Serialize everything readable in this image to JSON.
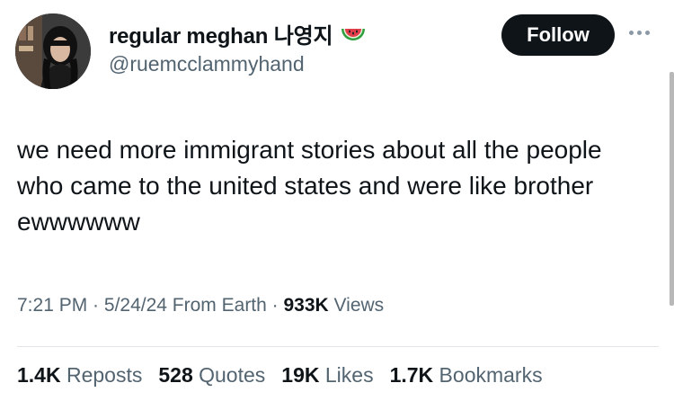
{
  "author": {
    "display_name": "regular meghan 나영지",
    "handle": "@ruemcclammyhand",
    "emoji_icon": "watermelon-icon"
  },
  "follow_label": "Follow",
  "tweet": {
    "text": "we need more immigrant stories about all the people who came to the united states and were like brother ewwwwww"
  },
  "meta": {
    "time": "7:21 PM",
    "sep1": " · ",
    "date": "5/24/24",
    "source": " From Earth",
    "sep2": " · ",
    "views_count": "933K",
    "views_label": " Views"
  },
  "stats": [
    {
      "count": "1.4K",
      "label": " Reposts"
    },
    {
      "count": "528",
      "label": " Quotes"
    },
    {
      "count": "19K",
      "label": " Likes"
    },
    {
      "count": "1.7K",
      "label": " Bookmarks"
    }
  ],
  "colors": {
    "text_primary": "#0f1419",
    "text_secondary": "#536471",
    "follow_bg": "#0f1419"
  }
}
